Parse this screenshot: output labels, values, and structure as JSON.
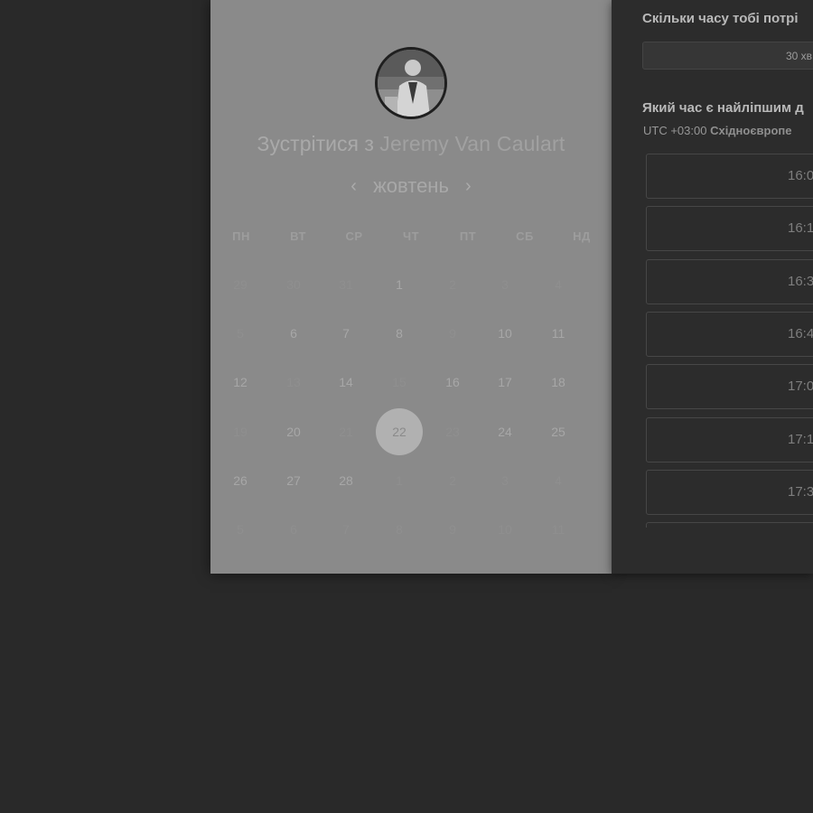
{
  "left": {
    "title_prefix": "Зустрітися з",
    "host_name": "Jeremy Van Caulart",
    "month": "жовтень",
    "prev_arrow": "‹",
    "next_arrow": "›",
    "weekdays": [
      "ПН",
      "ВТ",
      "СР",
      "ЧТ",
      "ПТ",
      "СБ",
      "НД"
    ],
    "weeks": [
      [
        "29",
        "30",
        "31",
        "1",
        "2",
        "3",
        "4"
      ],
      [
        "5",
        "6",
        "7",
        "8",
        "9",
        "10",
        "11"
      ],
      [
        "12",
        "13",
        "14",
        "15",
        "16",
        "17",
        "18"
      ],
      [
        "19",
        "20",
        "21",
        "22",
        "23",
        "24",
        "25"
      ],
      [
        "26",
        "27",
        "28",
        "1",
        "2",
        "3",
        "4"
      ],
      [
        "5",
        "6",
        "7",
        "8",
        "9",
        "10",
        "11"
      ]
    ],
    "available_days": [
      [
        false,
        false,
        false,
        true,
        false,
        false,
        false
      ],
      [
        false,
        true,
        true,
        true,
        false,
        true,
        true
      ],
      [
        true,
        false,
        true,
        false,
        true,
        true,
        true
      ],
      [
        false,
        true,
        false,
        true,
        false,
        true,
        true
      ],
      [
        true,
        true,
        true,
        false,
        false,
        false,
        false
      ],
      [
        false,
        false,
        false,
        false,
        false,
        false,
        false
      ]
    ],
    "selected_day": "22"
  },
  "right": {
    "duration_question": "Скільки часу тобі потрі",
    "duration_value": "30 хв",
    "time_question": "Який час є найліпшим д",
    "tz_offset": "UTC +03:00",
    "tz_name": "Східноєвропе",
    "slots": [
      "16:0",
      "16:1",
      "16:3",
      "16:4",
      "17:0",
      "17:1",
      "17:3"
    ]
  },
  "colors": {
    "page_bg": "#292929",
    "calendar_bg": "#8a8a8a",
    "times_bg": "#2c2c2c",
    "selected_day_bg": "#b1b1b1"
  }
}
